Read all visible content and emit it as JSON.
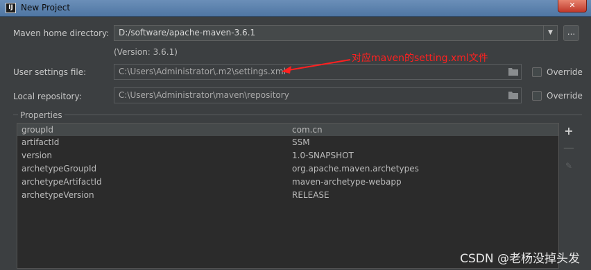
{
  "window": {
    "title": "New Project",
    "app_icon": "intellij-icon",
    "close_label": "✕"
  },
  "maven_home": {
    "label": "Maven home directory:",
    "value": "D:/software/apache-maven-3.6.1",
    "version": "(Version: 3.6.1)",
    "browse_label": "..."
  },
  "user_settings": {
    "label": "User settings file:",
    "value": "C:\\Users\\Administrator\\.m2\\settings.xml",
    "override_label": "Override"
  },
  "local_repo": {
    "label": "Local repository:",
    "value": "C:\\Users\\Administrator\\maven\\repository",
    "override_label": "Override"
  },
  "annotation": {
    "text": "对应maven的setting.xml文件",
    "color": "#ff2020"
  },
  "properties": {
    "legend": "Properties",
    "rows": [
      {
        "key": "groupId",
        "value": "com.cn"
      },
      {
        "key": "artifactId",
        "value": "SSM"
      },
      {
        "key": "version",
        "value": "1.0-SNAPSHOT"
      },
      {
        "key": "archetypeGroupId",
        "value": "org.apache.maven.archetypes"
      },
      {
        "key": "archetypeArtifactId",
        "value": "maven-archetype-webapp"
      },
      {
        "key": "archetypeVersion",
        "value": "RELEASE"
      }
    ]
  },
  "watermark": "CSDN @老杨没掉头发"
}
